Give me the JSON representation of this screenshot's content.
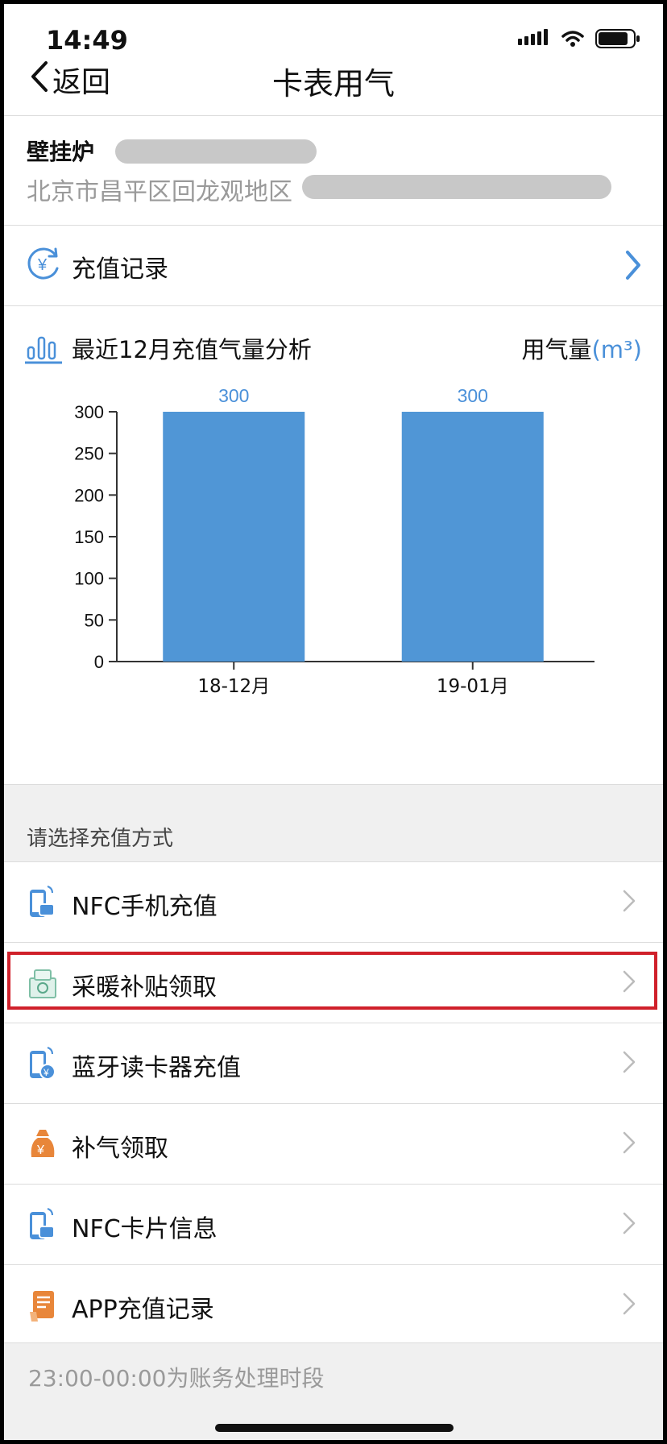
{
  "status_bar": {
    "time": "14:49"
  },
  "nav": {
    "back_label": "返回",
    "title": "卡表用气"
  },
  "device": {
    "name": "壁挂炉",
    "address": "北京市昌平区回龙观地区"
  },
  "recharge_record": {
    "label": "充值记录"
  },
  "chart_section": {
    "title": "最近12月充值气量分析",
    "unit_prefix": "用气量",
    "unit_suffix": "(m³)"
  },
  "chart_data": {
    "type": "bar",
    "categories": [
      "18-12月",
      "19-01月"
    ],
    "values": [
      300,
      300
    ],
    "ylim": [
      0,
      300
    ],
    "yticks": [
      0,
      50,
      100,
      150,
      200,
      250,
      300
    ],
    "data_labels": [
      "300",
      "300"
    ],
    "title": "最近12月充值气量分析",
    "ylabel": "用气量(m³)",
    "bar_color": "#5096d6",
    "label_color": "#4a90d9"
  },
  "payment": {
    "section_label": "请选择充值方式",
    "items": [
      {
        "label": "NFC手机充值",
        "icon": "phone-nfc-icon"
      },
      {
        "label": "采暖补贴领取",
        "icon": "heating-subsidy-icon"
      },
      {
        "label": "蓝牙读卡器充值",
        "icon": "bluetooth-reader-icon"
      },
      {
        "label": "补气领取",
        "icon": "money-bag-icon"
      },
      {
        "label": "NFC卡片信息",
        "icon": "nfc-card-icon"
      },
      {
        "label": "APP充值记录",
        "icon": "app-record-icon"
      }
    ]
  },
  "footer": {
    "note": "23:00-00:00为账务处理时段"
  },
  "colors": {
    "accent": "#4a90d9",
    "highlight": "#d0202a",
    "orange": "#e8863a"
  }
}
